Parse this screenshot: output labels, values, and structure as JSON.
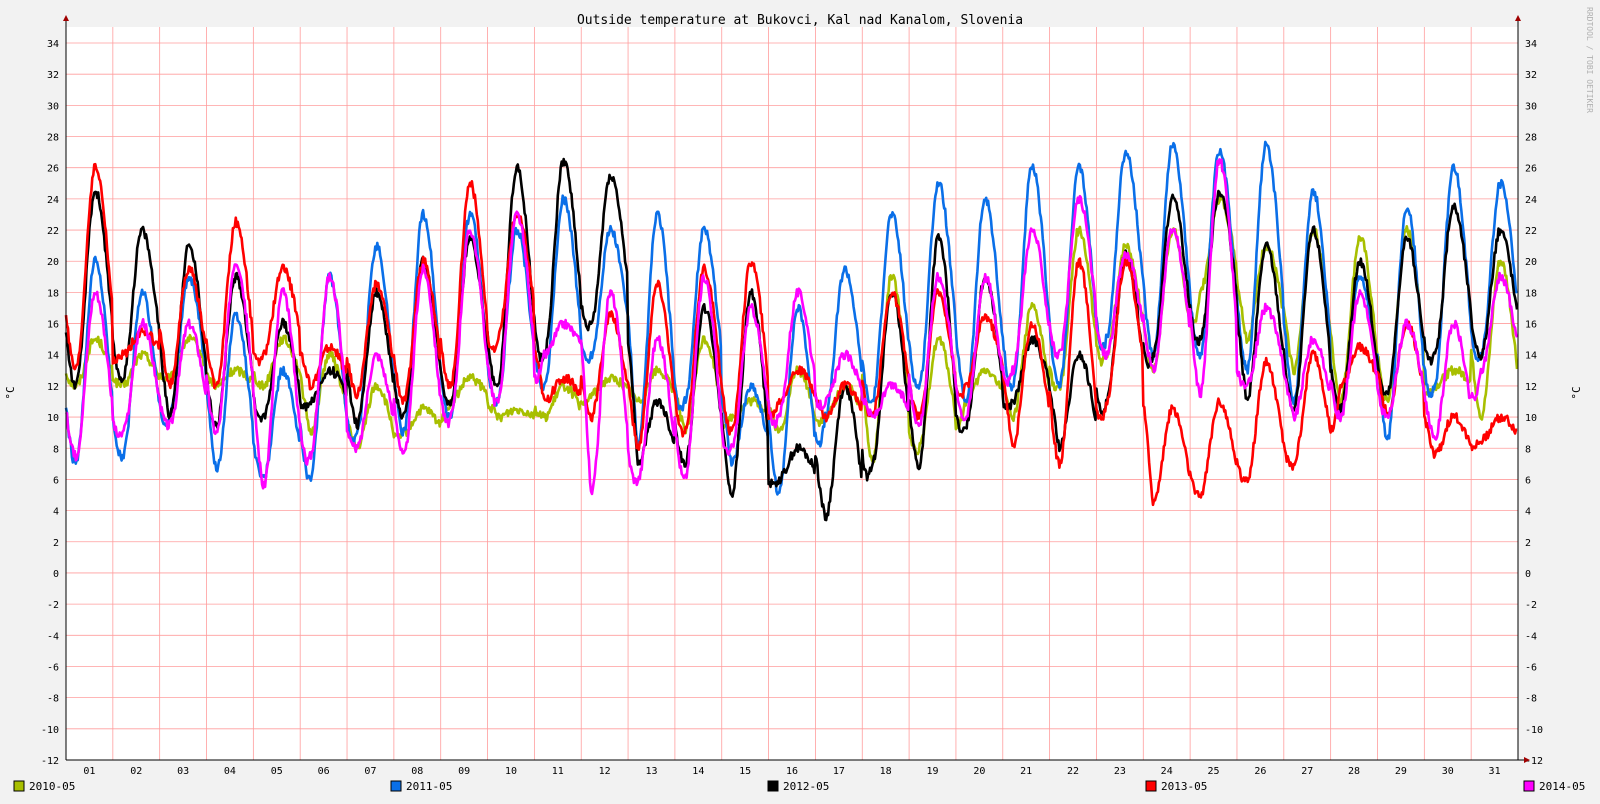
{
  "chart_data": {
    "type": "line",
    "title": "Outside temperature at Bukovci, Kal nad Kanalom, Slovenia",
    "xlabel": "",
    "ylabel": "°C",
    "ylabel_right": "°C",
    "watermark": "RRDTOOL / TOBI OETIKER",
    "ylim": [
      -12,
      35
    ],
    "yticks": [
      -12,
      -10,
      -8,
      -6,
      -4,
      -2,
      0,
      2,
      4,
      6,
      8,
      10,
      12,
      14,
      16,
      18,
      20,
      22,
      24,
      26,
      28,
      30,
      32,
      34
    ],
    "xlim": [
      0,
      31
    ],
    "categories": [
      "01",
      "02",
      "03",
      "04",
      "05",
      "06",
      "07",
      "08",
      "09",
      "10",
      "11",
      "12",
      "13",
      "14",
      "15",
      "16",
      "17",
      "18",
      "19",
      "20",
      "21",
      "22",
      "23",
      "24",
      "25",
      "26",
      "27",
      "28",
      "29",
      "30",
      "31"
    ],
    "grid": true,
    "legend_position": "bottom",
    "series": [
      {
        "name": "2010-05",
        "color": "#a8bf00",
        "days": [
          [
            12,
            15
          ],
          [
            12,
            14
          ],
          [
            12.5,
            15
          ],
          [
            12,
            13
          ],
          [
            12,
            15
          ],
          [
            9,
            14
          ],
          [
            8,
            12
          ],
          [
            9,
            10.5
          ],
          [
            11,
            12.5
          ],
          [
            10,
            10.5
          ],
          [
            10,
            12
          ],
          [
            11.5,
            12.5
          ],
          [
            11,
            13
          ],
          [
            9,
            15
          ],
          [
            10,
            11
          ],
          [
            9,
            13
          ],
          [
            10,
            12
          ],
          [
            7,
            19
          ],
          [
            8,
            15
          ],
          [
            11,
            13
          ],
          [
            10,
            17
          ],
          [
            12,
            22
          ],
          [
            14,
            21
          ],
          [
            13,
            22
          ],
          [
            18,
            24
          ],
          [
            15,
            21
          ],
          [
            13,
            22
          ],
          [
            11,
            21.5
          ],
          [
            11,
            22
          ],
          [
            12,
            13
          ],
          [
            10,
            20
          ]
        ]
      },
      {
        "name": "2011-05",
        "color": "#0a6fe8",
        "days": [
          [
            7,
            20
          ],
          [
            7.5,
            18
          ],
          [
            10,
            19
          ],
          [
            6.5,
            16.5
          ],
          [
            6,
            13
          ],
          [
            6,
            19
          ],
          [
            9,
            21
          ],
          [
            9,
            23
          ],
          [
            10,
            23
          ],
          [
            11,
            22
          ],
          [
            12,
            24
          ],
          [
            14,
            22
          ],
          [
            8,
            23
          ],
          [
            11,
            22
          ],
          [
            7,
            12
          ],
          [
            5,
            17
          ],
          [
            10,
            19.5
          ],
          [
            11,
            23
          ],
          [
            12,
            25
          ],
          [
            11,
            24
          ],
          [
            12,
            26
          ],
          [
            12,
            26
          ],
          [
            15,
            27
          ],
          [
            14,
            27.5
          ],
          [
            14,
            27
          ],
          [
            13,
            27.5
          ],
          [
            11,
            24.5
          ],
          [
            10,
            19
          ],
          [
            8.5,
            23.5
          ],
          [
            12,
            26
          ],
          [
            14,
            25
          ]
        ]
      },
      {
        "name": "2012-05",
        "color": "#000000",
        "days": [
          [
            12,
            24.5
          ],
          [
            12.5,
            22
          ],
          [
            10,
            21
          ],
          [
            9.5,
            19
          ],
          [
            10,
            16
          ],
          [
            11,
            13
          ],
          [
            9.5,
            18
          ],
          [
            10,
            20
          ],
          [
            11,
            21.5
          ],
          [
            12,
            26
          ],
          [
            14,
            26.5
          ],
          [
            16,
            25.5
          ],
          [
            7,
            11
          ],
          [
            7,
            17
          ],
          [
            5,
            18
          ],
          [
            6,
            8
          ],
          [
            3.5,
            12
          ],
          [
            7,
            18
          ],
          [
            6.8,
            21.5
          ],
          [
            9.5,
            19
          ],
          [
            11,
            15
          ],
          [
            8,
            14
          ],
          [
            11,
            20.5
          ],
          [
            14,
            24
          ],
          [
            15,
            24.5
          ],
          [
            11,
            21
          ],
          [
            10.5,
            22
          ],
          [
            10.5,
            20
          ],
          [
            11.5,
            21.5
          ],
          [
            14,
            23.5
          ],
          [
            14,
            22
          ]
        ]
      },
      {
        "name": "2013-05",
        "color": "#ff0000",
        "days": [
          [
            13,
            26
          ],
          [
            14,
            15.5
          ],
          [
            12,
            19.5
          ],
          [
            12,
            22.5
          ],
          [
            14,
            19.5
          ],
          [
            12,
            14.5
          ],
          [
            11.5,
            18.5
          ],
          [
            11,
            20
          ],
          [
            12,
            25
          ],
          [
            15,
            23
          ],
          [
            11,
            12.5
          ],
          [
            10,
            16.5
          ],
          [
            8,
            18.5
          ],
          [
            9,
            19.5
          ],
          [
            9,
            20
          ],
          [
            11,
            13
          ],
          [
            10,
            12
          ],
          [
            10,
            18
          ],
          [
            10,
            18
          ],
          [
            12,
            16.5
          ],
          [
            8,
            16
          ],
          [
            7,
            20
          ],
          [
            11,
            20
          ],
          [
            4.5,
            10.5
          ],
          [
            5,
            11
          ],
          [
            6,
            13.5
          ],
          [
            7,
            14
          ],
          [
            12,
            14.5
          ],
          [
            10,
            16
          ],
          [
            7.5,
            10
          ],
          [
            8.5,
            10
          ]
        ]
      },
      {
        "name": "2014-05",
        "color": "#ff00ff",
        "days": [
          [
            7.5,
            18
          ],
          [
            9,
            16
          ],
          [
            9.5,
            16
          ],
          [
            9,
            20
          ],
          [
            5.5,
            18
          ],
          [
            7.5,
            19
          ],
          [
            8,
            14
          ],
          [
            7.5,
            19.5
          ],
          [
            10,
            22
          ],
          [
            11,
            23
          ],
          [
            14,
            16
          ],
          [
            5,
            18
          ],
          [
            6,
            15
          ],
          [
            6,
            19
          ],
          [
            8,
            17
          ],
          [
            10,
            18
          ],
          [
            11,
            14
          ],
          [
            10,
            12
          ],
          [
            9.5,
            19
          ],
          [
            10,
            19
          ],
          [
            13,
            22
          ],
          [
            14,
            24
          ],
          [
            14,
            20.5
          ],
          [
            13,
            22
          ],
          [
            11.5,
            26.5
          ],
          [
            12,
            17
          ],
          [
            10,
            15
          ],
          [
            10,
            18
          ],
          [
            10,
            16
          ],
          [
            8.5,
            16
          ],
          [
            13,
            19
          ]
        ]
      }
    ]
  }
}
